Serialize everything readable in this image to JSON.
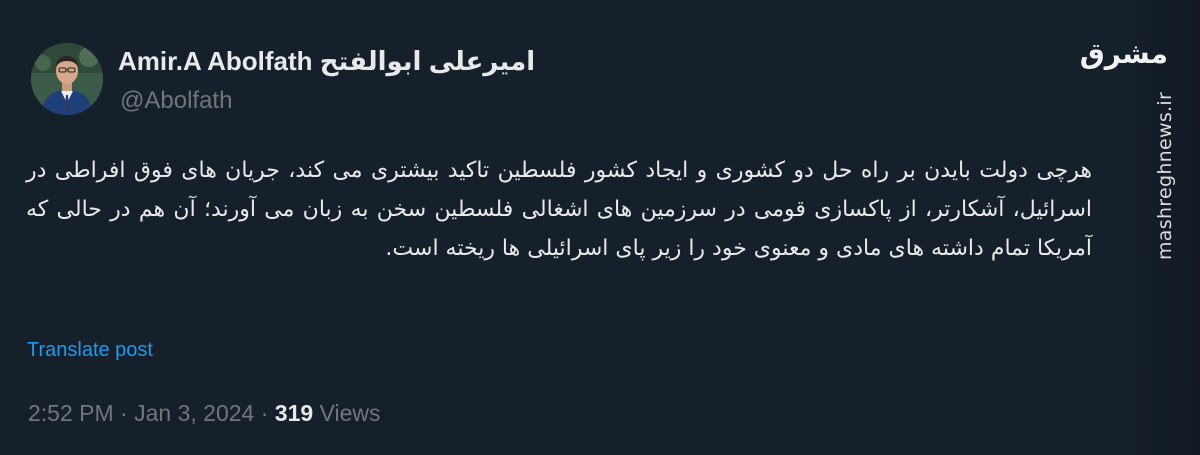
{
  "tweet": {
    "display_name": "Amir.A Abolfath امیرعلی ابوالفتح",
    "handle": "@Abolfath",
    "text": "هرچی دولت بایدن بر راه حل دو کشوری و ایجاد کشور فلسطین تاکید بیشتری می کند، جریان های فوق افراطی در اسرائیل، آشکارتر، از پاکسازی قومی در سرزمین های اشغالی فلسطین سخن به زبان می آورند؛ آن هم در حالی که آمریکا تمام داشته های مادی و معنوی خود را زیر پای اسرائیلی ها ریخته است.",
    "translate_label": "Translate post",
    "time": "2:52 PM",
    "separator": "·",
    "date": "Jan 3, 2024",
    "views_count": "319",
    "views_label": "Views"
  },
  "watermark": {
    "logo_text": "مشرق",
    "url": "mashreghnews.ir"
  },
  "colors": {
    "background": "#16202b",
    "primary_text": "#e7e9ea",
    "secondary_text": "#71767b",
    "link": "#1d9bf0"
  },
  "icons": {
    "avatar": "profile-photo"
  }
}
